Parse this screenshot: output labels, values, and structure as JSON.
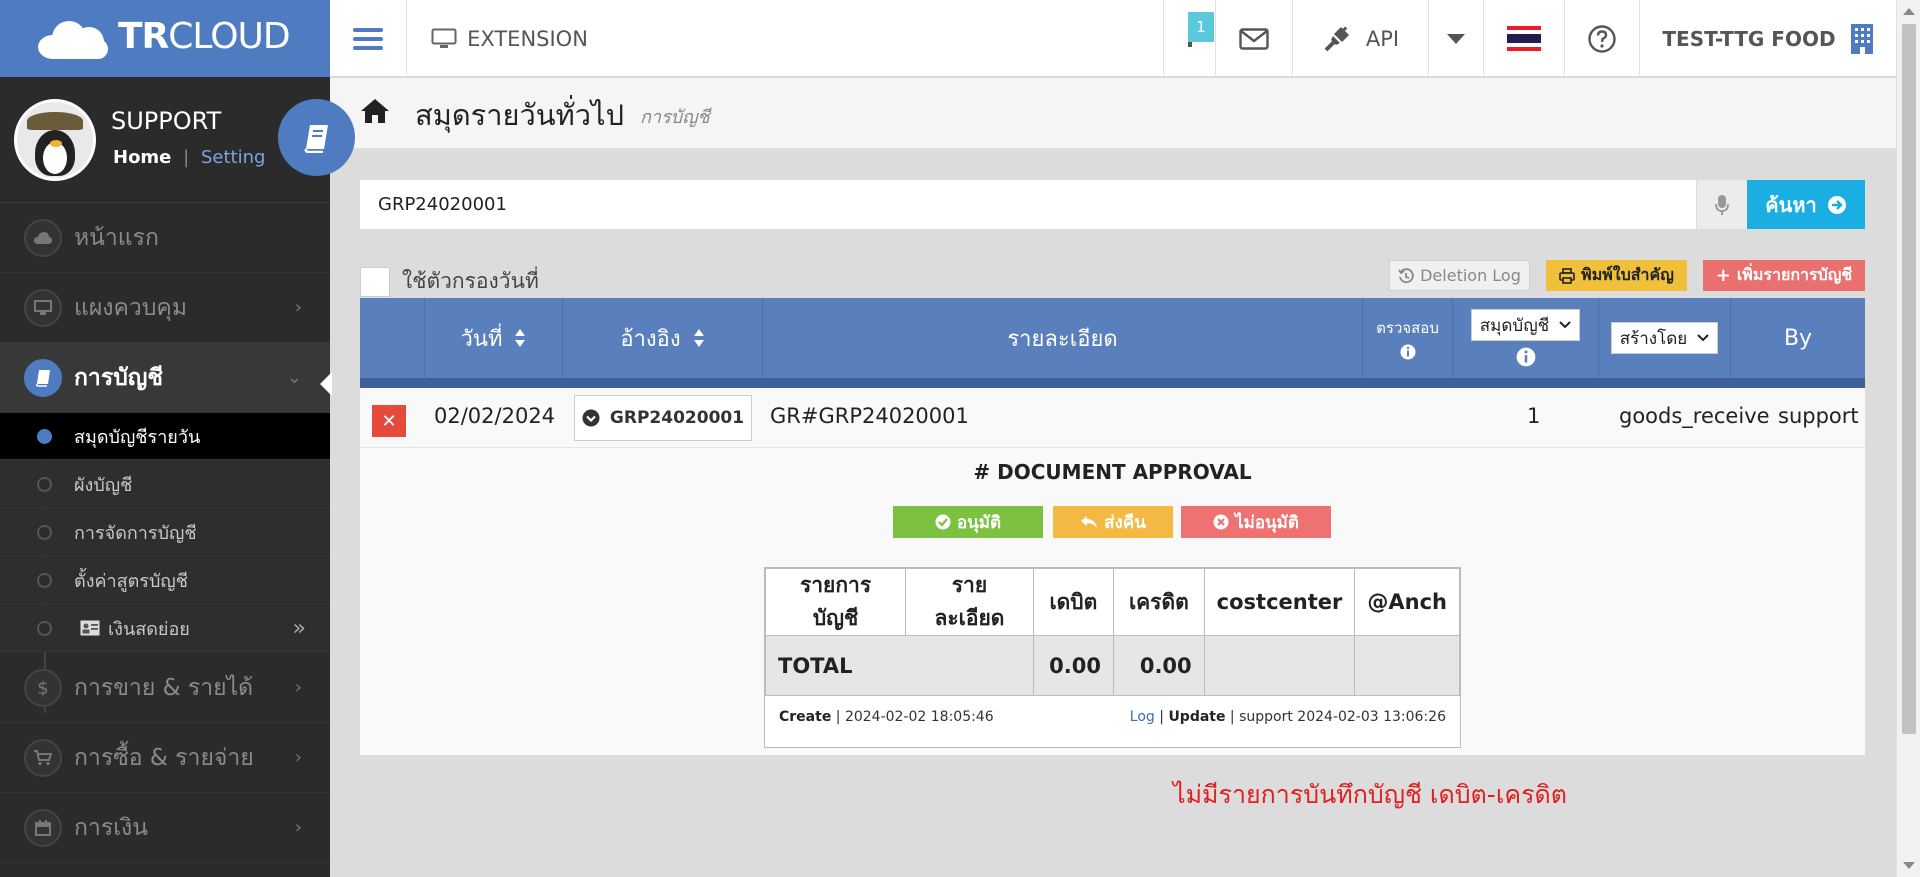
{
  "brand": {
    "logo_bold": "TR",
    "logo_light": "CLOUD"
  },
  "topbar": {
    "extension_label": "EXTENSION",
    "notification_count": "1",
    "api_label": "API",
    "company_name": "TEST-TTG FOOD",
    "flag_colors": [
      "#ed1c24",
      "#ffffff",
      "#241d4f",
      "#241d4f",
      "#ffffff",
      "#ed1c24"
    ]
  },
  "profile": {
    "name": "SUPPORT",
    "home_link": "Home",
    "separator": "|",
    "setting_link": "Setting"
  },
  "sidebar": {
    "items": [
      {
        "label": "หน้าแรก",
        "icon": "cloud-icon"
      },
      {
        "label": "แผงควบคุม",
        "icon": "monitor-icon"
      },
      {
        "label": "การบัญชี",
        "icon": "book-icon"
      },
      {
        "label": "การขาย & รายได้",
        "icon": "dollar-icon"
      },
      {
        "label": "การซื้อ & รายจ่าย",
        "icon": "cart-icon"
      },
      {
        "label": "การเงิน",
        "icon": "calendar-icon"
      }
    ],
    "sub_items": [
      {
        "label": "สมุดบัญชีรายวัน"
      },
      {
        "label": "ผังบัญชี"
      },
      {
        "label": "การจัดการบัญชี"
      },
      {
        "label": "ตั้งค่าสูตรบัญชี"
      },
      {
        "label": "เงินสดย่อย"
      }
    ]
  },
  "page": {
    "title": "สมุดรายวันทั่วไป",
    "subtitle": "การบัญชี"
  },
  "search": {
    "value": "GRP24020001",
    "button_label": "ค้นหา"
  },
  "filter": {
    "date_filter_label": "ใช้ตัวกรองวันที่"
  },
  "actions": {
    "deletion_log": "Deletion Log",
    "print": "พิมพ์ใบสำคัญ",
    "add": "เพิ่มรายการบัญชี"
  },
  "grid": {
    "headers": {
      "date": "วันที่",
      "reference": "อ้างอิง",
      "detail": "รายละเอียด",
      "check": "ตรวจสอบ",
      "book_select": "สมุดบัญชี",
      "created_by_select": "สร้างโดย",
      "by": "By"
    },
    "entry": {
      "date": "02/02/2024",
      "reference": "GRP24020001",
      "detail": "GR#GRP24020001",
      "book": "1",
      "created_by": "goods_receive",
      "by": "support"
    }
  },
  "approval": {
    "title": "# DOCUMENT APPROVAL",
    "approve": "อนุมัติ",
    "return": "ส่งคืน",
    "reject": "ไม่อนุมัติ"
  },
  "ledger": {
    "columns": [
      "รายการบัญชี",
      "รายละเอียด",
      "เดบิต",
      "เครดิต",
      "costcenter",
      "@Anch"
    ],
    "total_label": "TOTAL",
    "total_debit": "0.00",
    "total_credit": "0.00",
    "create_label": "Create",
    "create_time": "2024-02-02 18:05:46",
    "log_label": "Log",
    "update_label": "Update",
    "update_info": "support 2024-02-03 13:06:26"
  },
  "message": {
    "no_entries": "ไม่มีรายการบันทึกบัญชี เดบิต-เครดิต"
  }
}
